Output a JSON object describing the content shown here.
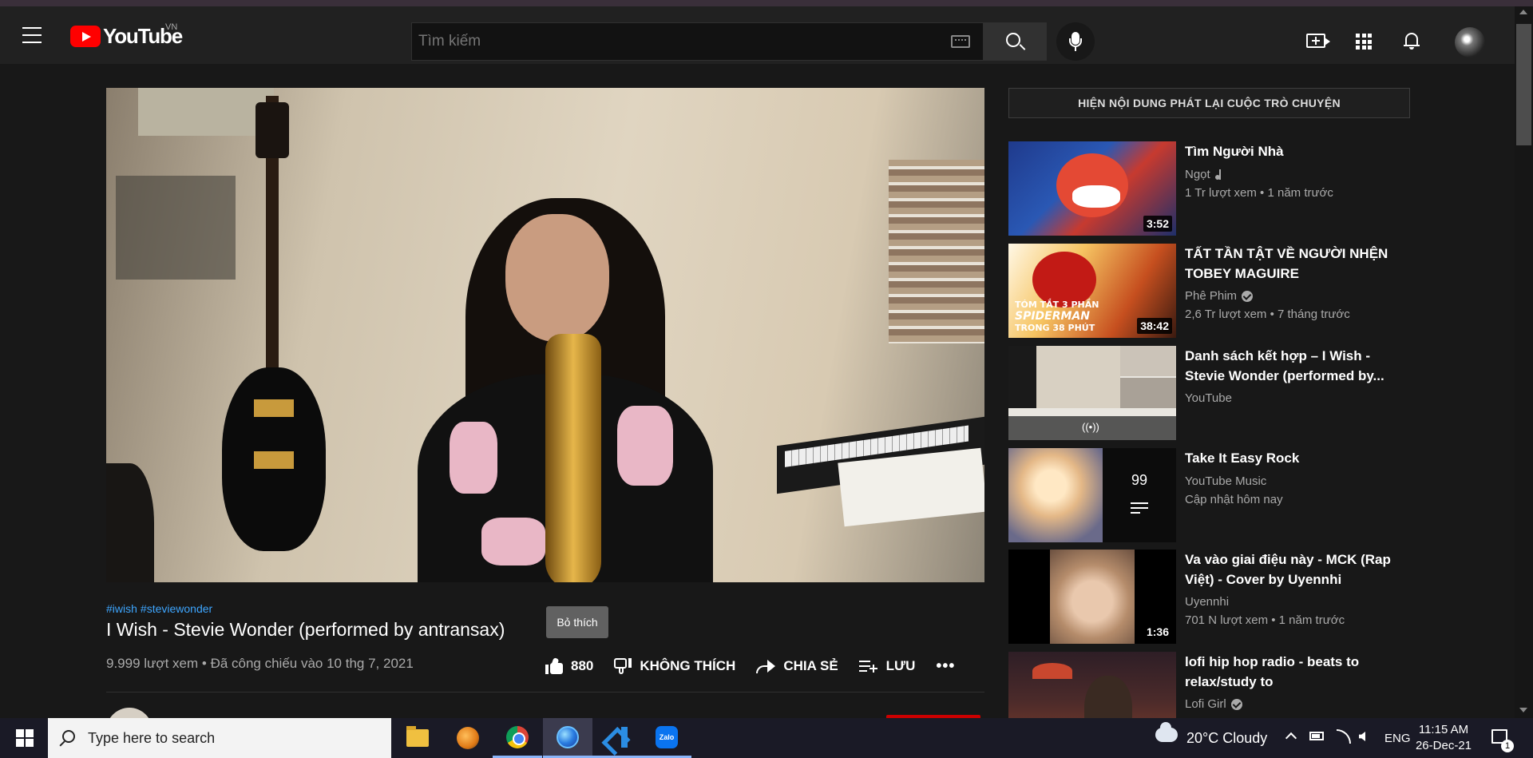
{
  "masthead": {
    "logo_text": "YouTube",
    "country_code": "VN",
    "search": {
      "placeholder": "Tìm kiếm",
      "value": ""
    },
    "icons": [
      "menu-icon",
      "youtube-logo",
      "keyboard-icon",
      "search-icon",
      "microphone-icon",
      "create-video-icon",
      "apps-icon",
      "notifications-icon",
      "avatar"
    ]
  },
  "video": {
    "hashtags": [
      "#iwish",
      "#steviewonder"
    ],
    "title": "I Wish - Stevie Wonder (performed by antransax)",
    "views": "9.999 lượt xem",
    "separator": "•",
    "premiered": "Đã công chiếu vào 10 thg 7, 2021",
    "like_count": "880",
    "dislike_label": "KHÔNG THÍCH",
    "share_label": "CHIA SẺ",
    "save_label": "LƯU",
    "more_label": "•••",
    "like_tooltip": "Bỏ thích"
  },
  "sidebar": {
    "chat_replay_label": "HIỆN NỘI DUNG PHÁT LẠI CUỘC TRÒ CHUYỆN",
    "items": [
      {
        "title": "Tìm Người Nhà",
        "channel": "Ngọt",
        "badge": "music-note-icon",
        "views": "1 Tr lượt xem",
        "age": "1 năm trước",
        "duration": "3:52"
      },
      {
        "title": "TẤT TẦN TẬT VỀ NGƯỜI NHỆN TOBEY MAGUIRE",
        "channel": "Phê Phim",
        "badge": "verified-icon",
        "views": "2,6 Tr lượt xem",
        "age": "7 tháng trước",
        "duration": "38:42",
        "thumb_caption_1": "TÓM TẮT 3 PHẦN",
        "thumb_caption_2": "SPIDERMAN",
        "thumb_caption_3": "TRONG 38 PHÚT"
      },
      {
        "title": "Danh sách kết hợp – I Wish - Stevie Wonder (performed by...",
        "channel": "YouTube",
        "live_icon": "((•))"
      },
      {
        "title": "Take It Easy Rock",
        "channel": "YouTube Music",
        "updated": "Cập nhật hôm nay",
        "video_count": "99"
      },
      {
        "title": "Va vào giai điệu này - MCK (Rap Việt) - Cover by Uyennhi",
        "channel": "Uyennhi",
        "views": "701 N lượt xem",
        "age": "1 năm trước",
        "duration": "1:36"
      },
      {
        "title": "lofi hip hop radio - beats to relax/study to",
        "channel": "Lofi Girl",
        "badge": "verified-icon"
      }
    ]
  },
  "taskbar": {
    "search_placeholder": "Type here to search",
    "apps": [
      "file-explorer-icon",
      "fl-studio-icon",
      "chrome-icon",
      "firefox-icon",
      "vscode-icon",
      "zalo-icon"
    ],
    "zalo_label": "Zalo",
    "weather": "20°C  Cloudy",
    "language": "ENG",
    "time": "11:15 AM",
    "date": "26-Dec-21",
    "notification_count": "1"
  },
  "colors": {
    "background": "#181818",
    "masthead": "#212121",
    "accent_red": "#ff0000",
    "link_blue": "#3ea6ff",
    "secondary_text": "#aaaaaa"
  }
}
